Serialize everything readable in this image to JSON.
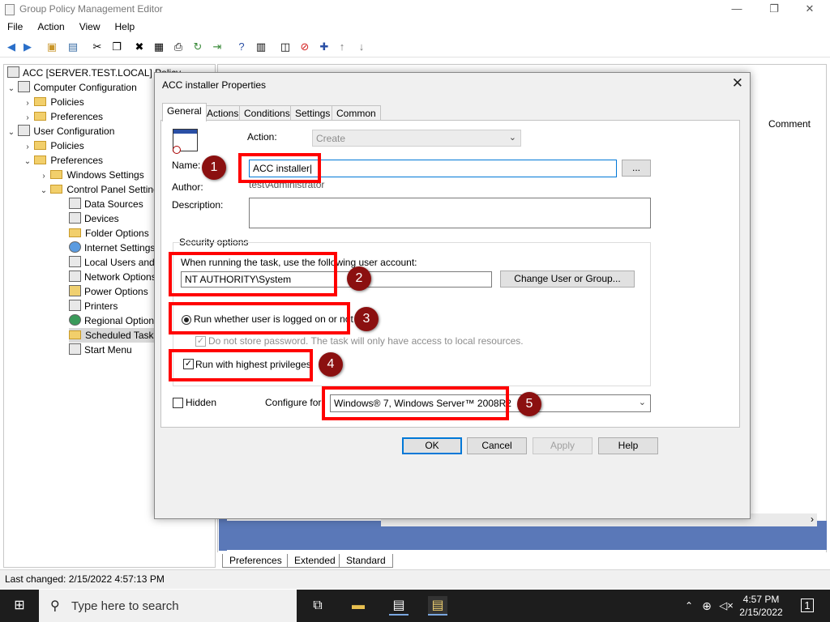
{
  "window": {
    "title": "Group Policy Management Editor",
    "controls": {
      "minimize": "—",
      "restore": "❐",
      "close": "✕"
    }
  },
  "menu": [
    "File",
    "Action",
    "View",
    "Help"
  ],
  "tree": {
    "root": "ACC [SERVER.TEST.LOCAL] Policy",
    "computer_config": "Computer Configuration",
    "cc_policies": "Policies",
    "cc_preferences": "Preferences",
    "user_config": "User Configuration",
    "uc_policies": "Policies",
    "uc_preferences": "Preferences",
    "windows_settings": "Windows Settings",
    "control_panel": "Control Panel Settings",
    "items": [
      "Data Sources",
      "Devices",
      "Folder Options",
      "Internet Settings",
      "Local Users and Groups",
      "Network Options",
      "Power Options",
      "Printers",
      "Regional Options",
      "Scheduled Tasks",
      "Start Menu"
    ]
  },
  "right_pane": {
    "column_comment": "Comment"
  },
  "bottom_tabs": [
    "Preferences",
    "Extended",
    "Standard"
  ],
  "status": "Last changed: 2/15/2022 4:57:13 PM",
  "dialog": {
    "title": "ACC installer Properties",
    "close": "✕",
    "tabs": [
      "General",
      "Actions",
      "Conditions",
      "Settings",
      "Common"
    ],
    "action_label": "Action:",
    "action_value": "Create",
    "name_label": "Name:",
    "name_value": "ACC installer",
    "browse_button": "...",
    "author_label": "Author:",
    "author_value": "test\\Administrator",
    "description_label": "Description:",
    "security_group": "Security options",
    "run_as_text": "When running the task, use the following user account:",
    "user_account": "NT AUTHORITY\\System",
    "change_user_button": "Change User or Group...",
    "run_whether": "Run whether user is logged on or not",
    "do_not_store": "Do not store password. The task will only have access to local resources.",
    "run_highest": "Run with highest privileges",
    "hidden_label": "Hidden",
    "configure_label": "Configure for:",
    "configure_value": "Windows® 7, Windows Server™ 2008R2",
    "ok": "OK",
    "cancel": "Cancel",
    "apply": "Apply",
    "help": "Help"
  },
  "annotations": [
    "1",
    "2",
    "3",
    "4",
    "5"
  ],
  "taskbar": {
    "search_placeholder": "Type here to search",
    "time": "4:57 PM",
    "date": "2/15/2022",
    "notification_count": "1"
  },
  "colors": {
    "annotation_red": "#ff0000",
    "bubble": "#8b1010",
    "accent": "#0078d7",
    "taskbar": "#1d1d1d"
  }
}
